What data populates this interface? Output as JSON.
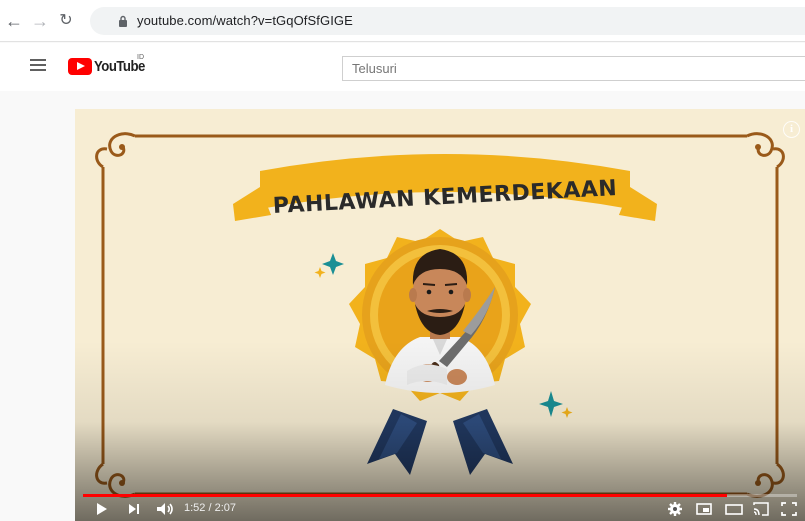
{
  "browser": {
    "url": "youtube.com/watch?v=tGqOfSfGIGE",
    "icons": [
      "back-arrow-icon",
      "forward-arrow-icon",
      "reload-icon",
      "lock-icon"
    ]
  },
  "header": {
    "logo_text": "YouTube",
    "region_code": "ID",
    "search_placeholder": "Telusuri"
  },
  "video": {
    "title_banner": "PAHLAWAN KEMERDEKAAN",
    "current_time": "1:52",
    "duration": "2:07",
    "time_separator": " / ",
    "progress_fraction": 0.902,
    "colors": {
      "background": "#f7edd3",
      "frame_brown": "#9a5a1a",
      "ribbon_gold": "#f2b21c",
      "medal_gold": "#e6a21c",
      "ribbon_navy": "#223a63",
      "sparkle_teal": "#1a8f95",
      "progress_red": "#ff0000"
    }
  },
  "controls": {
    "icons": [
      "play-icon",
      "next-icon",
      "volume-icon",
      "settings-icon",
      "miniplayer-icon",
      "theater-mode-icon",
      "cast-icon",
      "fullscreen-icon"
    ]
  }
}
